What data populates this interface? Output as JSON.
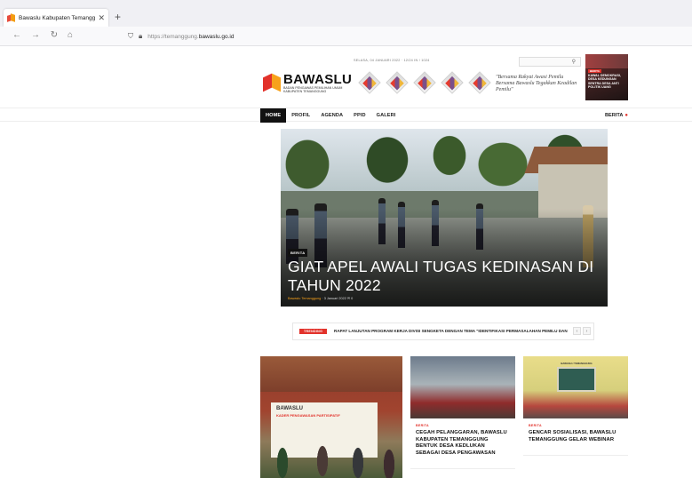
{
  "browser": {
    "tab_title": "Bawaslu Kabupaten Temanggung",
    "url_prefix": "https://temanggung.",
    "url_domain": "bawaslu.go.id",
    "icons": {
      "back": "arrow-left-icon",
      "forward": "arrow-right-icon",
      "reload": "reload-icon",
      "home": "home-icon",
      "shield": "shield-icon",
      "lock": "lock-icon",
      "close": "close-icon",
      "new_tab": "plus-icon"
    }
  },
  "header": {
    "date_line": "SELASA, 04 JANUARI 2022 · 12/24 IN / 1024",
    "logo_name": "BAWASLU",
    "logo_sub": "BADAN PENGAWAS PEMILIHAN UMUM KABUPATEN TEMANGGUNG",
    "tagline": "\"Bersama Rakyat Awasi Pemilu Bersama Bawaslu Tegakkan Keadilan Pemilu\"",
    "ad_badge": "BERITA",
    "ad_text": "KAWAL DEMOKRASI, DESA KEDUNGAN SENTRA DESA ANTI POLITIK UANG",
    "brand_colors": {
      "red": "#e2322b",
      "orange": "#f7a21b"
    }
  },
  "menu": {
    "items": [
      "HOME",
      "PROFIL",
      "AGENDA",
      "PPID",
      "GALERI"
    ],
    "right_label": "BERITA"
  },
  "hero": {
    "category": "BERITA",
    "title": "GIAT APEL AWALI TUGAS KEDINASAN DI TAHUN 2022",
    "author": "Bawaslu Temanggung",
    "date": "3 Januari 2022",
    "comments": "0"
  },
  "trending": {
    "label": "TRENDING",
    "text": "RAPAT LANJUTAN PROGRAM KERJA DIVISI SENGKETA DENGAN TEMA \"IDENTIFIKASI PERMASALAHAN PEMILU DAN"
  },
  "cards": {
    "big_banner_title": "BAWASLU",
    "big_banner_sub": "KADER PENGAWASAN PARTISIPATIF",
    "card1": {
      "category": "BERITA",
      "title": "CEGAH PELANGGARAN, BAWASLU KABUPATEN TEMANGGUNG BENTUK DESA KEDLUKAN SEBAGAI DESA PENGAWASAN"
    },
    "card2": {
      "category": "BERITA",
      "title": "GENCAR SOSIALISASI, BAWASLU TEMANGGUNG GELAR WEBINAR",
      "screen_text": "BAWASLU TEMANGGUNG"
    }
  }
}
